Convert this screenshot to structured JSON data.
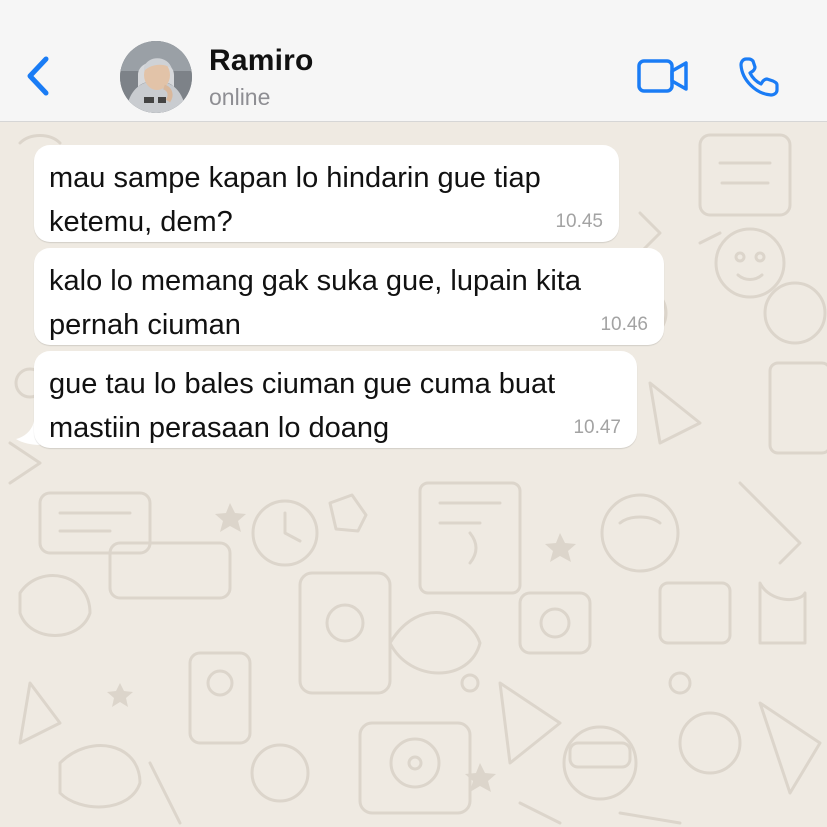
{
  "header": {
    "back_icon": "chevron-left-icon",
    "contact_name": "Ramiro",
    "contact_status": "online",
    "video_icon": "video-camera-icon",
    "call_icon": "phone-icon"
  },
  "messages": [
    {
      "text": "mau sampe kapan lo hindarin gue tiap ketemu, dem?",
      "time": "10.45"
    },
    {
      "text": "kalo lo memang gak suka gue, lupain kita pernah ciuman",
      "time": "10.46"
    },
    {
      "text": "gue tau lo bales ciuman gue cuma buat mastiin perasaan lo doang",
      "time": "10.47"
    }
  ],
  "colors": {
    "accent": "#1a7cf5",
    "header_bg": "#f6f6f6",
    "chat_bg": "#efeae2",
    "bubble_bg": "#ffffff",
    "time_text": "#a3a3a3"
  }
}
